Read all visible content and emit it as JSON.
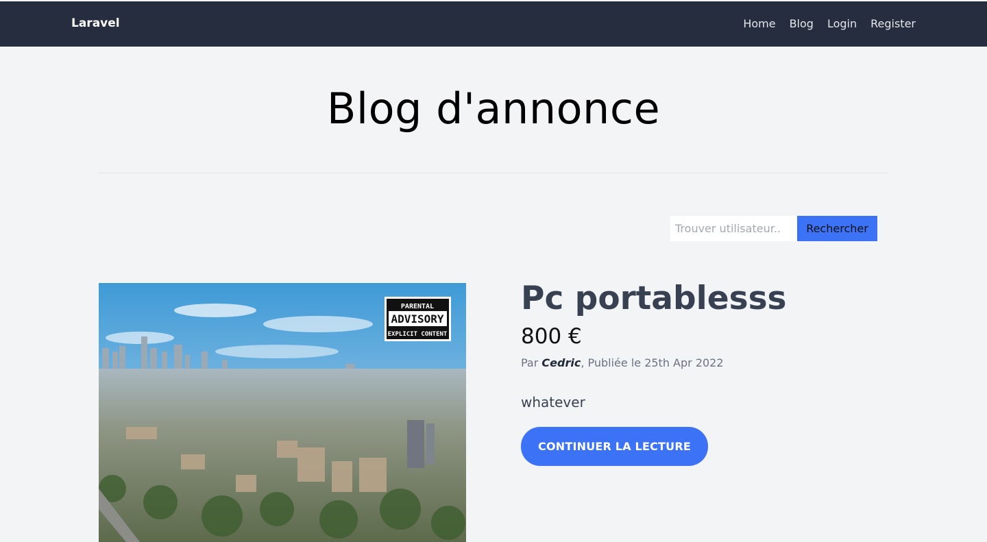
{
  "nav": {
    "brand": "Laravel",
    "links": [
      "Home",
      "Blog",
      "Login",
      "Register"
    ]
  },
  "page": {
    "title": "Blog d'annonce"
  },
  "search": {
    "placeholder": "Trouver utilisateur..",
    "value": "",
    "button_label": "Rechercher"
  },
  "post": {
    "image_badge": [
      "PARENTAL",
      "ADVISORY",
      "EXPLICIT CONTENT"
    ],
    "title": "Pc portablesss",
    "price": "800 €",
    "meta_prefix": "Par ",
    "author": "Cedric",
    "meta_suffix": ", Publiée le 25th Apr 2022",
    "description": "whatever",
    "cta_label": "CONTINUER LA LECTURE"
  },
  "colors": {
    "navbar": "#252d3f",
    "accent": "#3b72f6",
    "background": "#f3f4f6"
  }
}
